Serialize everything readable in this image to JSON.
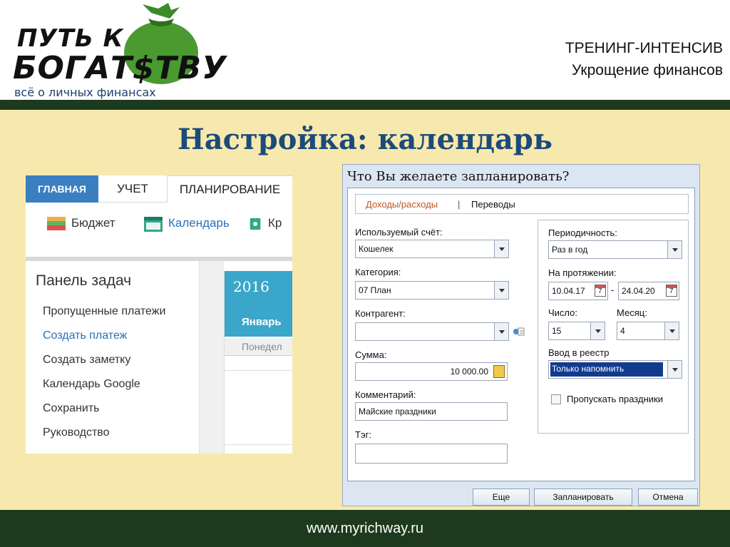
{
  "header": {
    "logo": {
      "line1": "ПУТЬ К",
      "line2": "БОГАТ$ТВУ",
      "tagline": "всё о личных финансах"
    },
    "title_line1": "ТРЕНИНГ-ИНТЕНСИВ",
    "title_line2": "Укрощение финансов"
  },
  "slide": {
    "title": "Настройка: календарь"
  },
  "app": {
    "tabs": [
      {
        "label": "ГЛАВНАЯ"
      },
      {
        "label": "УЧЕТ"
      },
      {
        "label": "ПЛАНИРОВАНИЕ"
      }
    ],
    "toolbar": {
      "budget": "Бюджет",
      "calendar": "Календарь",
      "cut_label": "Кр"
    },
    "task_panel": {
      "title": "Панель задач",
      "items": [
        {
          "label": "Пропущенные платежи"
        },
        {
          "label": "Создать платеж"
        },
        {
          "label": "Создать заметку"
        },
        {
          "label": "Календарь Google"
        },
        {
          "label": "Сохранить"
        },
        {
          "label": "Руководство"
        }
      ]
    },
    "calendar": {
      "year": "2016",
      "month": "Январь",
      "weekday": "Понедел"
    }
  },
  "dialog": {
    "title": "Что Вы желаете запланировать?",
    "tabs": {
      "income_expense": "Доходы/расходы",
      "separator": "|",
      "transfers": "Переводы"
    },
    "account": {
      "label": "Используемый счёт:",
      "value": "Кошелек"
    },
    "category": {
      "label": "Категория:",
      "value": "07 План"
    },
    "counterparty": {
      "label": "Контрагент:",
      "value": ""
    },
    "amount": {
      "label": "Сумма:",
      "value": "10 000.00"
    },
    "comment": {
      "label": "Комментарий:",
      "value": "Майские праздники"
    },
    "tag": {
      "label": "Тэг:",
      "value": ""
    },
    "periodicity": {
      "label": "Периодичность:",
      "value": "Раз в год"
    },
    "duration": {
      "label": "На протяжении:",
      "from": "10.04.17",
      "dash": "-",
      "to": "24.04.20"
    },
    "day": {
      "label": "Число:",
      "value": "15"
    },
    "month": {
      "label": "Месяц:",
      "value": "4"
    },
    "registry": {
      "label": "Ввод в реестр",
      "value": "Только напомнить"
    },
    "skip_holidays": {
      "label": "Пропускать праздники",
      "checked": false
    },
    "buttons": {
      "more": "Еще",
      "plan": "Запланировать",
      "cancel": "Отмена"
    }
  },
  "footer": {
    "url": "www.myrichway.ru"
  },
  "colors": {
    "header_stripe": "#1e3a1e",
    "slide_background": "#f7e9ad",
    "title_color": "#1c4b7a",
    "tab_active": "#3a7fc1",
    "calendar_header": "#3aa6c9",
    "link": "#2a72b6",
    "selection": "#123b8f"
  }
}
